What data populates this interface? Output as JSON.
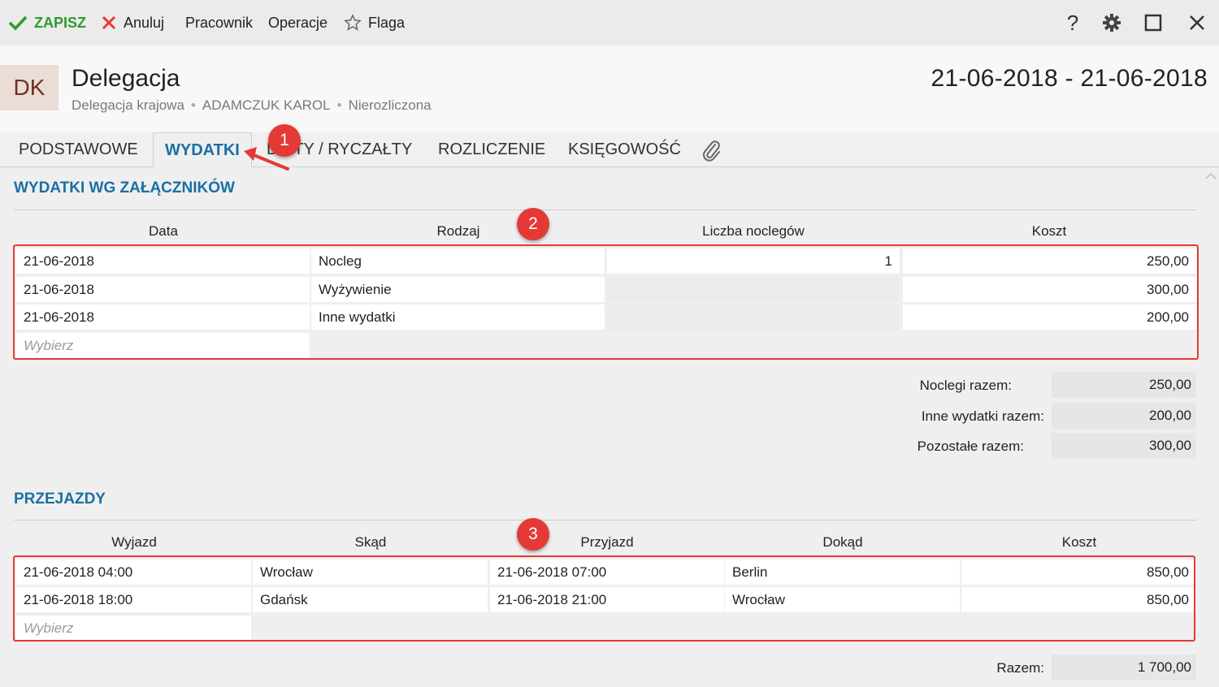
{
  "toolbar": {
    "save": "ZAPISZ",
    "cancel": "Anuluj",
    "employee": "Pracownik",
    "operations": "Operacje",
    "flag": "Flaga",
    "help_icon": "?"
  },
  "header": {
    "avatar": "DK",
    "title": "Delegacja",
    "type": "Delegacja krajowa",
    "person": "ADAMCZUK KAROL",
    "status": "Nierozliczona",
    "separator": "•",
    "date_range": "21-06-2018 - 21-06-2018"
  },
  "tabs": [
    {
      "label": "PODSTAWOWE"
    },
    {
      "label": "WYDATKI"
    },
    {
      "label": "DIETY / RYCZAŁTY"
    },
    {
      "label": "ROZLICZENIE"
    },
    {
      "label": "KSIĘGOWOŚĆ"
    }
  ],
  "expenses": {
    "title": "WYDATKI WG ZAŁĄCZNIKÓW",
    "columns": [
      "Data",
      "Rodzaj",
      "Liczba noclegów",
      "Koszt"
    ],
    "rows": [
      {
        "date": "21-06-2018",
        "type": "Nocleg",
        "nights": "1",
        "cost": "250,00"
      },
      {
        "date": "21-06-2018",
        "type": "Wyżywienie",
        "nights": "",
        "cost": "300,00"
      },
      {
        "date": "21-06-2018",
        "type": "Inne wydatki",
        "nights": "",
        "cost": "200,00"
      }
    ],
    "placeholder": "Wybierz",
    "summary": [
      {
        "label": "Noclegi razem:",
        "value": "250,00"
      },
      {
        "label": "Inne wydatki razem:",
        "value": "200,00"
      },
      {
        "label": "Pozostałe razem:",
        "value": "300,00"
      }
    ]
  },
  "trips": {
    "title": "PRZEJAZDY",
    "columns": [
      "Wyjazd",
      "Skąd",
      "Przyjazd",
      "Dokąd",
      "Koszt"
    ],
    "rows": [
      {
        "departure": "21-06-2018 04:00",
        "from": "Wrocław",
        "arrival": "21-06-2018 07:00",
        "to": "Berlin",
        "cost": "850,00"
      },
      {
        "departure": "21-06-2018 18:00",
        "from": "Gdańsk",
        "arrival": "21-06-2018 21:00",
        "to": "Wrocław",
        "cost": "850,00"
      }
    ],
    "placeholder": "Wybierz",
    "total_label": "Razem:",
    "total_value": "1 700,00"
  },
  "annotations": [
    "1",
    "2",
    "3"
  ],
  "colors": {
    "accent": "#1a6fa5",
    "save": "#2e9a2e",
    "cancel": "#e53935",
    "annotation": "#e53935"
  }
}
